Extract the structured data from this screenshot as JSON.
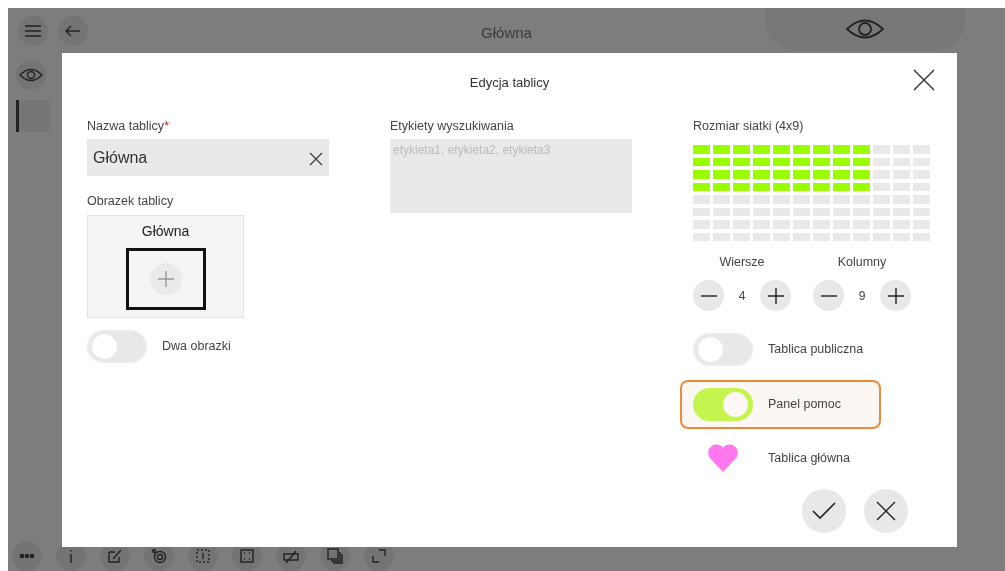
{
  "app": {
    "title": "Główna"
  },
  "dialog": {
    "title": "Edycja tablicy",
    "name_field": {
      "label": "Nazwa tablicy",
      "required_mark": "*",
      "value": "Główna"
    },
    "image": {
      "label": "Obrazek tablicy",
      "caption": "Główna"
    },
    "tags_field": {
      "label": "Etykiety wyszukiwania",
      "placeholder": "etykieta1, etykieta2, etykieta3"
    },
    "grid_size": {
      "label": "Rozmiar siatki (4x9)"
    },
    "steppers": [
      {
        "label": "Wiersze",
        "value": "4"
      },
      {
        "label": "Kolumny",
        "value": "9"
      }
    ],
    "toggles": [
      {
        "label": "Dwa obrazki",
        "on": false,
        "focused": false
      },
      {
        "label": "Tablica publiczna",
        "on": false,
        "focused": false
      },
      {
        "label": "Panel pomoc",
        "on": true,
        "focused": true
      }
    ],
    "home_board": {
      "label": "Tablica główna",
      "checked": true
    }
  }
}
